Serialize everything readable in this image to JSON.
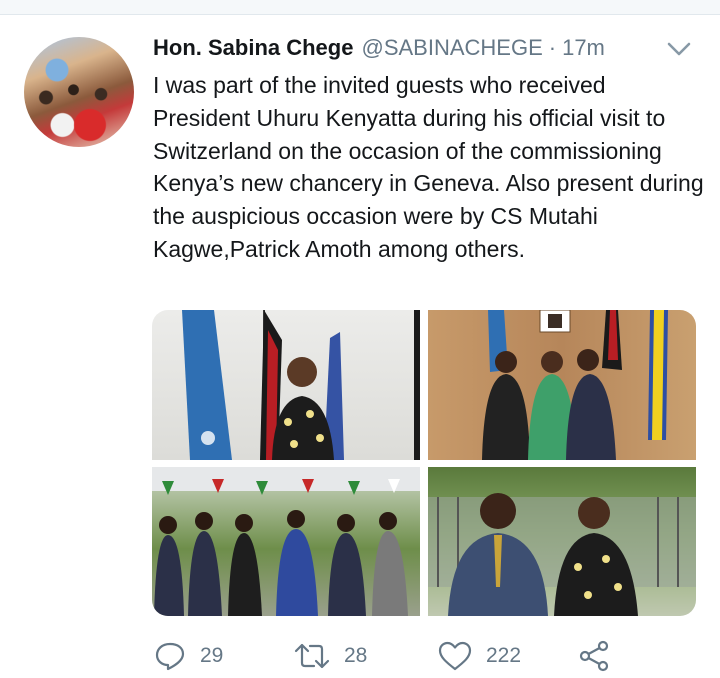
{
  "tweet": {
    "author_name": "Hon. Sabina Chege",
    "handle": "@SABINACHEGE",
    "separator": "·",
    "time": "17m",
    "text": " I  was part of the invited guests who received President Uhuru Kenyatta during his official visit to Switzerland on the occasion of the commissioning Kenya’s new chancery in Geneva. Also present during the auspicious occasion were by CS Mutahi Kagwe,Patrick Amoth among others."
  },
  "actions": {
    "reply_count": "29",
    "retweet_count": "28",
    "like_count": "222"
  },
  "icons": {
    "reply": "reply-icon",
    "retweet": "retweet-icon",
    "like": "heart-icon",
    "share": "share-icon",
    "menu": "chevron-down-icon"
  },
  "colors": {
    "text": "#14171a",
    "secondary": "#657786",
    "background": "#ffffff"
  }
}
